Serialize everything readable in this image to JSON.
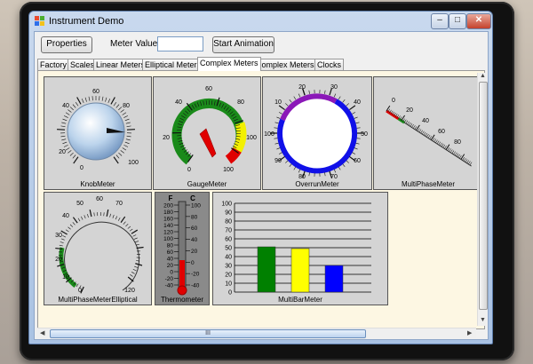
{
  "window": {
    "title": "Instrument Demo",
    "minimize": "–",
    "maximize": "□",
    "close": "✕"
  },
  "toolbar": {
    "properties_label": "Properties",
    "meter_value_label": "Meter Value:",
    "meter_value": "",
    "start_animation_label": "Start Animation"
  },
  "tabs": [
    {
      "label": "Factory"
    },
    {
      "label": "Scales"
    },
    {
      "label": "Linear Meters"
    },
    {
      "label": "Elliptical Meters"
    },
    {
      "label": "Complex Meters",
      "active": true
    },
    {
      "label": "Complex Meters 2"
    },
    {
      "label": "Clocks"
    }
  ],
  "meters": {
    "knob": {
      "caption": "KnobMeter",
      "ticks": [
        "0",
        "20",
        "40",
        "60",
        "80",
        "100"
      ]
    },
    "gauge": {
      "caption": "GaugeMeter",
      "ticks": [
        "0",
        "20",
        "40",
        "60",
        "80",
        "100"
      ],
      "colors": {
        "green": "#1a8a1a",
        "yellow": "#f3f000",
        "red": "#e00000"
      }
    },
    "overrun": {
      "caption": "OverrunMeter",
      "ticks": [
        "10",
        "20",
        "30",
        "40",
        "50",
        "60",
        "70",
        "80",
        "90",
        "100"
      ],
      "colors": {
        "purple": "#8b18b8",
        "blue": "#1010e8"
      }
    },
    "multiphase": {
      "caption": "MultiPhaseMeter",
      "ticks": [
        "0",
        "20",
        "40",
        "60",
        "80"
      ]
    },
    "multiphase_elliptical": {
      "caption": "MultiPhaseMeterElliptical",
      "ticks": [
        "0",
        "10",
        "20",
        "30",
        "40",
        "50",
        "60",
        "70",
        "80",
        "90",
        "100",
        "110",
        "120"
      ]
    },
    "thermometer": {
      "caption": "Thermometer",
      "f_label": "F",
      "c_label": "C",
      "f_ticks": [
        "200",
        "180",
        "160",
        "140",
        "120",
        "100",
        "80",
        "60",
        "40",
        "20",
        "0",
        "-20",
        "-40"
      ],
      "c_ticks": [
        "100",
        "80",
        "60",
        "40",
        "20",
        "0",
        "-20",
        "-40"
      ]
    },
    "multibar": {
      "caption": "MultiBarMeter",
      "y_ticks": [
        "100",
        "90",
        "80",
        "70",
        "60",
        "50",
        "40",
        "30",
        "20",
        "10",
        "0"
      ],
      "bars": [
        {
          "value": 51,
          "color": "#008000"
        },
        {
          "value": 49,
          "color": "#ffff00"
        },
        {
          "value": 30,
          "color": "#0000ff"
        }
      ]
    }
  },
  "scrollbar": {
    "grip": "III"
  }
}
